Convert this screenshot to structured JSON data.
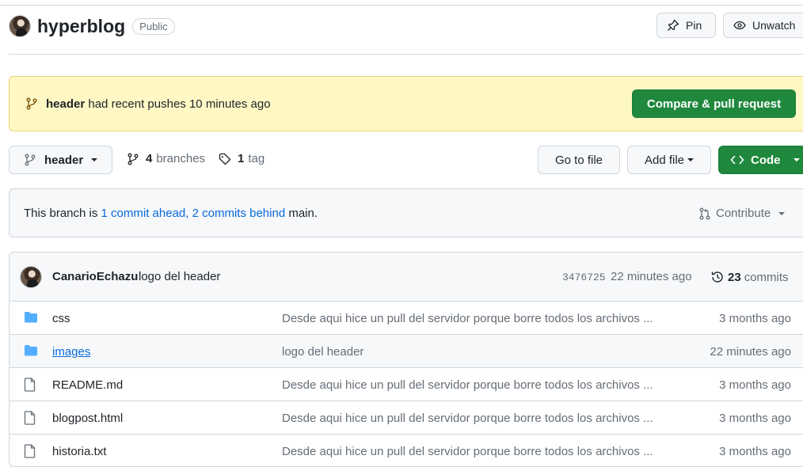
{
  "repo": {
    "name": "hyperblog",
    "visibility": "Public",
    "pin_label": "Pin",
    "watch_label": "Unwatch"
  },
  "push_banner": {
    "branch": "header",
    "message": "had recent pushes 10 minutes ago",
    "button_label": "Compare & pull request"
  },
  "branch_bar": {
    "current_branch": "header",
    "branches_count": "4",
    "branches_label": "branches",
    "tags_count": "1",
    "tags_label": "tag",
    "goto_label": "Go to file",
    "add_label": "Add file",
    "code_label": "Code"
  },
  "compare": {
    "prefix": "This branch is",
    "ahead": "1 commit ahead,",
    "behind": "2 commits behind",
    "suffix": "main.",
    "contribute_label": "Contribute"
  },
  "latest_commit": {
    "author": "CanarioEchazu",
    "message": "logo del header",
    "sha": "3476725",
    "time": "22 minutes ago",
    "count": "23",
    "count_label": "commits"
  },
  "files": [
    {
      "name": "css",
      "type": "folder",
      "message": "Desde aqui hice un pull del servidor porque borre todos los archivos ...",
      "time": "3 months ago"
    },
    {
      "name": "images",
      "type": "folder",
      "message": "logo del header",
      "time": "22 minutes ago"
    },
    {
      "name": "README.md",
      "type": "file",
      "message": "Desde aqui hice un pull del servidor porque borre todos los archivos ...",
      "time": "3 months ago"
    },
    {
      "name": "blogpost.html",
      "type": "file",
      "message": "Desde aqui hice un pull del servidor porque borre todos los archivos ...",
      "time": "3 months ago"
    },
    {
      "name": "historia.txt",
      "type": "file",
      "message": "Desde aqui hice un pull del servidor porque borre todos los archivos ...",
      "time": "3 months ago"
    }
  ],
  "colors": {
    "primary_green": "#1f883d",
    "link_blue": "#0969da",
    "banner_yellow": "#fff8c5",
    "folder_blue": "#54aeff"
  }
}
